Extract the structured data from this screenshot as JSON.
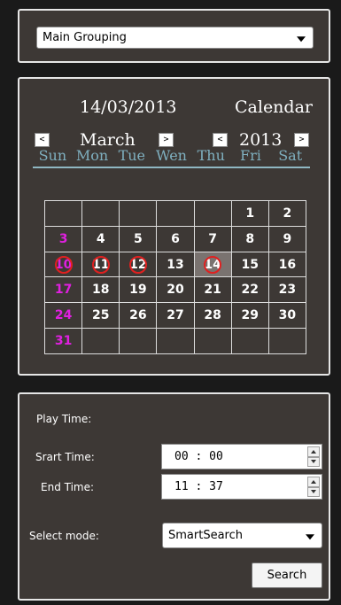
{
  "grouping": {
    "selected": "Main Grouping"
  },
  "calendar": {
    "date": "14/03/2013",
    "label": "Calendar",
    "month": "March",
    "year": "2013",
    "prev_month": "<",
    "next_month": ">",
    "prev_year": "<",
    "next_year": ">",
    "weekdays": [
      "Sun",
      "Mon",
      "Tue",
      "Wen",
      "Thu",
      "Fri",
      "Sat"
    ],
    "weeks": [
      [
        "",
        "",
        "",
        "",
        "",
        "1",
        "2"
      ],
      [
        "3",
        "4",
        "5",
        "6",
        "7",
        "8",
        "9"
      ],
      [
        "10",
        "11",
        "12",
        "13",
        "14",
        "15",
        "16"
      ],
      [
        "17",
        "18",
        "19",
        "20",
        "21",
        "22",
        "23"
      ],
      [
        "24",
        "25",
        "26",
        "27",
        "28",
        "29",
        "30"
      ],
      [
        "31",
        "",
        "",
        "",
        "",
        "",
        ""
      ]
    ],
    "recorded_days": [
      "10",
      "11",
      "12",
      "14"
    ],
    "selected_day": "14",
    "sunday_color": "#e020e0",
    "record_marker_color": "#e02020"
  },
  "playback": {
    "play_time_label": "Play Time:",
    "start_label": "Srart Time:",
    "start_value": "00 : 00",
    "end_label": "End Time:",
    "end_value": "11 : 37",
    "mode_label": "Select mode:",
    "mode_value": "SmartSearch",
    "search_label": "Search"
  }
}
